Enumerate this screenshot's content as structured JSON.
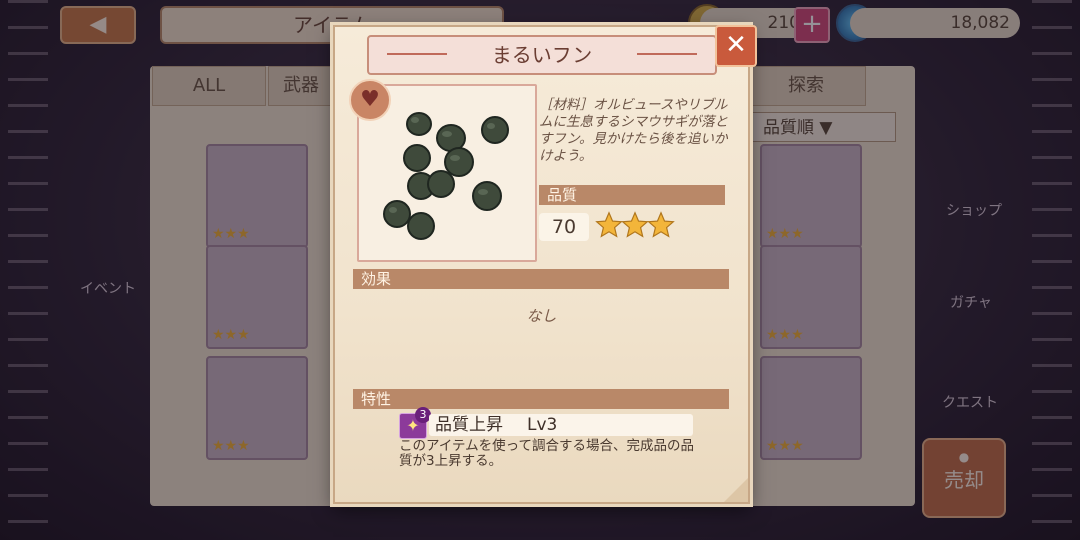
{
  "background": {
    "title": "アイテム",
    "currency_1": "210",
    "currency_2": "18,082",
    "tabs": [
      "ALL",
      "武器",
      "探索"
    ],
    "sort_label": "品質順",
    "side_menu": [
      "ショップ",
      "ガチャ",
      "クエスト",
      "イベント"
    ],
    "sell_label": "売却",
    "badge_number": "3"
  },
  "popup": {
    "title": "まるいフン",
    "description": "［材料］オルビュースやリブルムに生息するシマウサギが落とすフン。見かけたら後を追いかけよう。",
    "quality_label": "品質",
    "quality_value": "70",
    "quality_stars": 3,
    "effect_label": "効果",
    "effect_text": "なし",
    "trait_label": "特性",
    "trait_badge_level": "3",
    "trait_name": "品質上昇",
    "trait_level": "Lv3",
    "trait_description": "このアイテムを使って調合する場合、完成品の品質が3上昇する。",
    "colors": {
      "section_bar": "#b98868",
      "star": "#f0b23a",
      "close_button": "#c95a3c"
    }
  }
}
